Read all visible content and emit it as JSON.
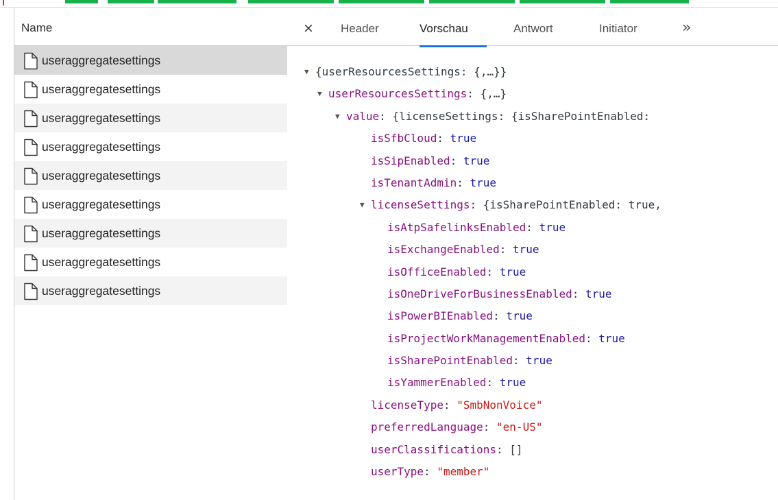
{
  "request_list": {
    "header": "Name",
    "items": [
      "useraggregatesettings",
      "useraggregatesettings",
      "useraggregatesettings",
      "useraggregatesettings",
      "useraggregatesettings",
      "useraggregatesettings",
      "useraggregatesettings",
      "useraggregatesettings",
      "useraggregatesettings"
    ],
    "selected_index": 0
  },
  "tabs": {
    "close": "×",
    "items": [
      "Header",
      "Vorschau",
      "Antwort",
      "Initiator"
    ],
    "active": "Vorschau",
    "more": "»"
  },
  "tree": {
    "root_preview": "{userResourcesSettings: {,…}}",
    "urs_key": "userResourcesSettings",
    "urs_preview": "{,…}",
    "value_key": "value",
    "value_preview": "{licenseSettings: {isSharePointEnabled:",
    "isSfbCloud_key": "isSfbCloud",
    "isSfbCloud_val": "true",
    "isSipEnabled_key": "isSipEnabled",
    "isSipEnabled_val": "true",
    "isTenantAdmin_key": "isTenantAdmin",
    "isTenantAdmin_val": "true",
    "ls_key": "licenseSettings",
    "ls_preview": "{isSharePointEnabled: true,",
    "isAtpSafelinksEnabled_key": "isAtpSafelinksEnabled",
    "isAtpSafelinksEnabled_val": "true",
    "isExchangeEnabled_key": "isExchangeEnabled",
    "isExchangeEnabled_val": "true",
    "isOfficeEnabled_key": "isOfficeEnabled",
    "isOfficeEnabled_val": "true",
    "isOneDriveForBusinessEnabled_key": "isOneDriveForBusinessEnabled",
    "isOneDriveForBusinessEnabled_val": "true",
    "isPowerBIEnabled_key": "isPowerBIEnabled",
    "isPowerBIEnabled_val": "true",
    "isProjectWorkManagementEnabled_key": "isProjectWorkManagementEnabled",
    "isProjectWorkManagementEnabled_val": "true",
    "isSharePointEnabled_key": "isSharePointEnabled",
    "isSharePointEnabled_val": "true",
    "isYammerEnabled_key": "isYammerEnabled",
    "isYammerEnabled_val": "true",
    "licenseType_key": "licenseType",
    "licenseType_val": "\"SmbNonVoice\"",
    "preferredLanguage_key": "preferredLanguage",
    "preferredLanguage_val": "\"en-US\"",
    "userClassifications_key": "userClassifications",
    "userClassifications_val": "[]",
    "userType_key": "userType",
    "userType_val": "\"member\""
  },
  "colors": {
    "key": "#881280",
    "boolean": "#1a1aa6",
    "string": "#c41a16",
    "active_tab_underline": "#1a73e8",
    "selected_row": "#d9d9d9",
    "waterfall_bar": "#19b14a"
  }
}
